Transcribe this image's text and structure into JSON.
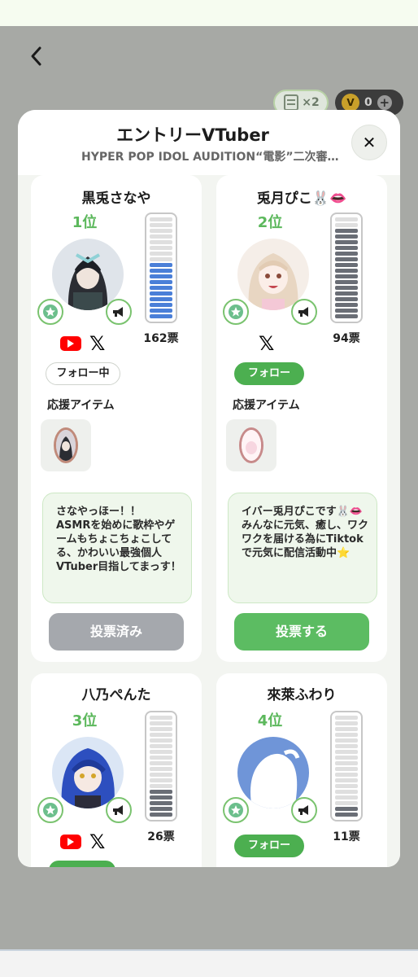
{
  "header": {
    "back_icon": "chevron-left-icon",
    "ticket_count": "×2",
    "coin_symbol": "V",
    "coin_count": "0",
    "plus_label": "+"
  },
  "modal": {
    "title": "エントリーVTuber",
    "subtitle": "HYPER POP IDOL AUDITION“電影”二次審…",
    "close_label": "✕"
  },
  "cards": [
    {
      "name": "黒兎さなや",
      "rank": "1位",
      "votes": "162票",
      "gauge_level": 0.55,
      "gauge_color": "#4a7fd8",
      "sns": [
        "youtube",
        "x"
      ],
      "follow_label": "フォロー中",
      "support_label": "応援アイテム",
      "bio": "さなやっほー！！\nASMRを始めに歌枠やゲームもちょこちょこしてる、かわいい最強個人VTuber目指してまっす！",
      "vote_label": "投票済み"
    },
    {
      "name": "兎月ぴこ🐰👄",
      "rank": "2位",
      "votes": "94票",
      "gauge_level": 0.9,
      "gauge_color": "#6a6e76",
      "sns": [
        "x"
      ],
      "follow_label": "フォロー",
      "support_label": "応援アイテム",
      "bio": "イバー兎月ぴこです🐰👄\nみんなに元気、癒し、ワクワクを届ける為にTiktokで元気に配信活動中⭐",
      "vote_label": "投票する"
    },
    {
      "name": "八乃ぺんた",
      "rank": "3位",
      "votes": "26票",
      "gauge_level": 0.3,
      "gauge_color": "#6a6e76",
      "sns": [
        "youtube",
        "x"
      ]
    },
    {
      "name": "來萊ふわり",
      "rank": "4位",
      "votes": "11票",
      "gauge_level": 0.1,
      "gauge_color": "#6a6e76",
      "sns": [],
      "follow_label": "フォロー"
    }
  ],
  "icons": {
    "left_badge": "star-sparkle-icon",
    "right_badge": "megaphone-icon",
    "ticket": "ticket-icon"
  }
}
